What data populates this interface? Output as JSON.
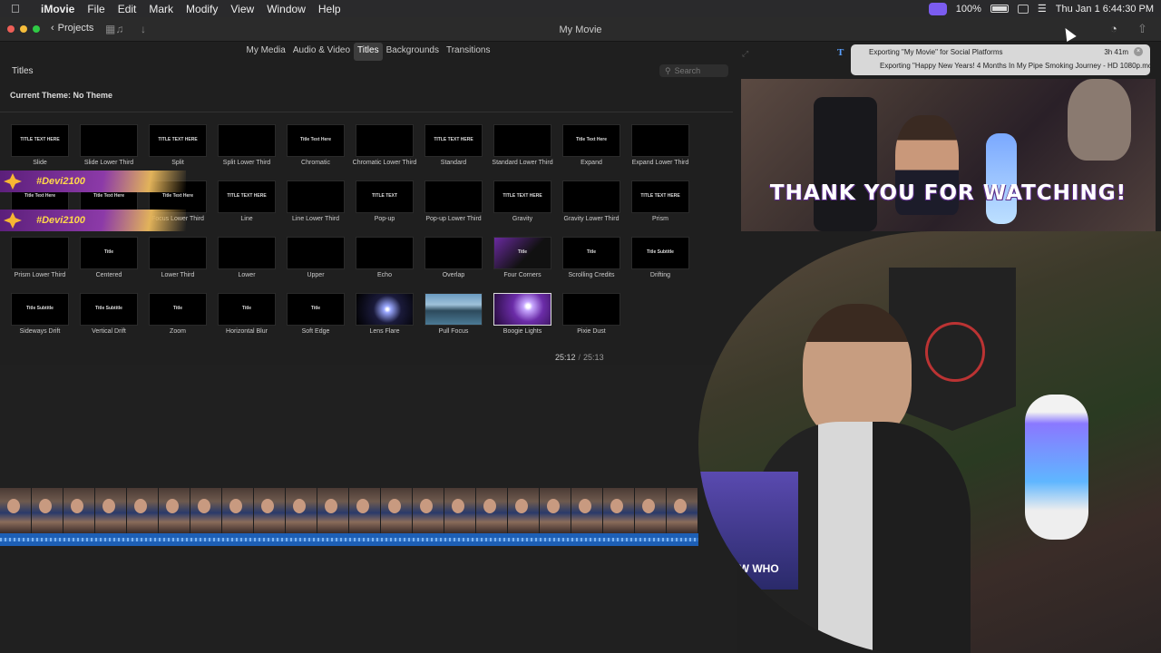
{
  "menubar": {
    "app": "iMovie",
    "items": [
      "File",
      "Edit",
      "Mark",
      "Modify",
      "View",
      "Window",
      "Help"
    ],
    "battery": "100%",
    "clock": "Thu Jan 1  6:44:30 PM"
  },
  "titlebar": {
    "back_label": "Projects",
    "title": "My Movie"
  },
  "browser": {
    "tabs": [
      "My Media",
      "Audio & Video",
      "Titles",
      "Backgrounds",
      "Transitions"
    ],
    "active_tab": "Titles",
    "section": "Titles",
    "search_placeholder": "Search",
    "theme": "Current Theme: No Theme"
  },
  "titles": [
    {
      "label": "Slide",
      "thumb": "TITLE TEXT HERE"
    },
    {
      "label": "Slide Lower Third",
      "thumb": ""
    },
    {
      "label": "Split",
      "thumb": "TITLE TEXT HERE"
    },
    {
      "label": "Split Lower Third",
      "thumb": ""
    },
    {
      "label": "Chromatic",
      "thumb": "Title Text Here"
    },
    {
      "label": "Chromatic Lower Third",
      "thumb": ""
    },
    {
      "label": "Standard",
      "thumb": "TITLE TEXT HERE"
    },
    {
      "label": "Standard Lower Third",
      "thumb": ""
    },
    {
      "label": "Expand",
      "thumb": "Title Text Here"
    },
    {
      "label": "Expand Lower Third",
      "thumb": ""
    },
    {
      "label": "",
      "thumb": "Title Text Here"
    },
    {
      "label": "cus",
      "thumb": "Title Text Here"
    },
    {
      "label": "Focus Lower Third",
      "thumb": "Title Text Here"
    },
    {
      "label": "Line",
      "thumb": "TITLE TEXT HERE"
    },
    {
      "label": "Line Lower Third",
      "thumb": ""
    },
    {
      "label": "Pop-up",
      "thumb": "TITLE TEXT"
    },
    {
      "label": "Pop-up Lower Third",
      "thumb": ""
    },
    {
      "label": "Gravity",
      "thumb": "TITLE TEXT HERE"
    },
    {
      "label": "Gravity Lower Third",
      "thumb": ""
    },
    {
      "label": "Prism",
      "thumb": "TITLE TEXT HERE"
    },
    {
      "label": "Prism Lower Third",
      "thumb": ""
    },
    {
      "label": "Centered",
      "thumb": "Title"
    },
    {
      "label": "Lower Third",
      "thumb": ""
    },
    {
      "label": "Lower",
      "thumb": ""
    },
    {
      "label": "Upper",
      "thumb": ""
    },
    {
      "label": "Echo",
      "thumb": ""
    },
    {
      "label": "Overlap",
      "thumb": ""
    },
    {
      "label": "Four Corners",
      "thumb": "Title"
    },
    {
      "label": "Scrolling Credits",
      "thumb": "Title"
    },
    {
      "label": "Drifting",
      "thumb": "Title Subtitle"
    },
    {
      "label": "Sideways Drift",
      "thumb": "Title Subtitle"
    },
    {
      "label": "Vertical Drift",
      "thumb": "Title Subtitle"
    },
    {
      "label": "Zoom",
      "thumb": "Title"
    },
    {
      "label": "Horizontal Blur",
      "thumb": "Title"
    },
    {
      "label": "Soft Edge",
      "thumb": "Title"
    },
    {
      "label": "Lens Flare",
      "thumb": ""
    },
    {
      "label": "Pull Focus",
      "thumb": ""
    },
    {
      "label": "Boogie Lights",
      "thumb": ""
    },
    {
      "label": "Pixie Dust",
      "thumb": ""
    }
  ],
  "stream_tags": [
    "#Devi2100",
    "#Devi2100"
  ],
  "timecode": {
    "current": "25:12",
    "total": "25:13"
  },
  "export": {
    "line1": "Exporting \"My Movie\" for Social Platforms",
    "eta": "3h 41m",
    "line2": "Exporting \"Happy New Years! 4 Months In My Pipe Smoking Journey - HD 1080p.mov\""
  },
  "viewer": {
    "overlay_text": "THANK YOU FOR WATCHING!"
  },
  "webcam": {
    "box_text": "U KNOW WHO"
  },
  "colors": {
    "accent": "#7b5cf0",
    "audio": "#1d5fb5",
    "close": "#ee5f57",
    "min": "#f6bd3b",
    "max": "#2fca45"
  }
}
